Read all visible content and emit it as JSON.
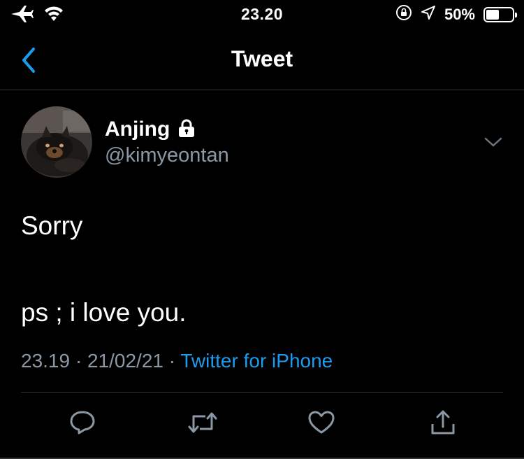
{
  "status_bar": {
    "time": "23.20",
    "battery_percent": "50%",
    "battery_level": 0.5,
    "icons": [
      "airplane-icon",
      "wifi-icon",
      "rotation-lock-icon",
      "location-arrow-icon",
      "battery-icon"
    ]
  },
  "nav": {
    "title": "Tweet",
    "back_icon": "chevron-left-icon"
  },
  "tweet": {
    "display_name": "Anjing",
    "protected_icon": "lock-icon",
    "handle": "@kimyeontan",
    "text": "Sorry\n\nps ; i love you.",
    "time": "23.19",
    "date": "21/02/21",
    "separator": "·",
    "source": "Twitter for iPhone"
  },
  "actions": [
    {
      "name": "reply",
      "icon": "reply-icon"
    },
    {
      "name": "retweet",
      "icon": "retweet-icon"
    },
    {
      "name": "like",
      "icon": "heart-icon"
    },
    {
      "name": "share",
      "icon": "share-icon"
    }
  ],
  "colors": {
    "background": "#000000",
    "text": "#ffffff",
    "secondary_text": "#8b98a5",
    "accent": "#1d9bf0",
    "divider": "#2f3336"
  }
}
